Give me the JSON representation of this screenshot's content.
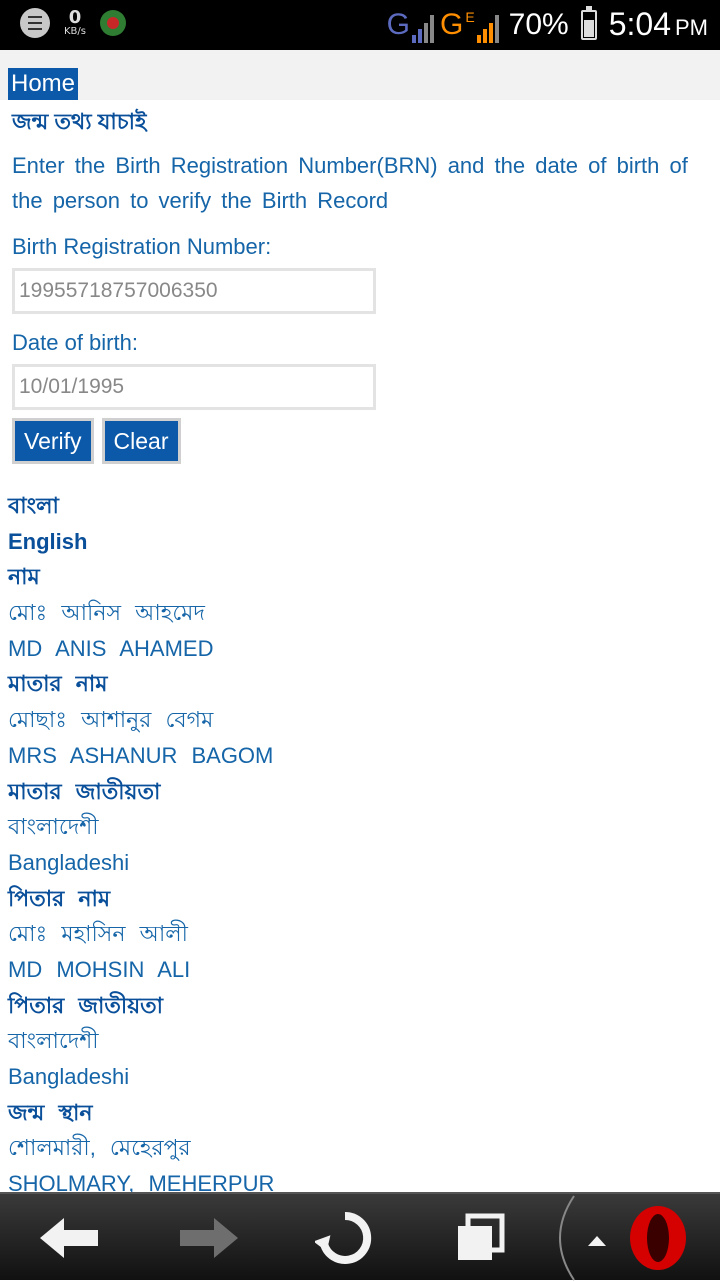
{
  "status_bar": {
    "data_speed_value": "0",
    "data_speed_unit": "KB/s",
    "network_1": "G",
    "network_2": "G",
    "network_2_sup": "E",
    "battery": "70%",
    "time": "5:04",
    "ampm": "PM"
  },
  "nav": {
    "home_label": "Home"
  },
  "form": {
    "title_bn": "জন্ম তথ্য যাচাই",
    "description": "Enter the Birth Registration Number(BRN) and the date of birth of the person to verify the Birth Record",
    "brn_label": "Birth Registration Number:",
    "brn_value": "19955718757006350",
    "dob_label": "Date of birth:",
    "dob_value": "10/01/1995",
    "verify_label": "Verify",
    "clear_label": "Clear"
  },
  "record": {
    "lang_bn": "বাংলা",
    "lang_en": "English",
    "name_label": "নাম",
    "name_bn": "মোঃ আনিস আহমেদ",
    "name_en": "MD ANIS AHAMED",
    "mother_name_label": "মাতার নাম",
    "mother_name_bn": "মোছাঃ আশানুর বেগম",
    "mother_name_en": "MRS ASHANUR BAGOM",
    "mother_nationality_label": "মাতার জাতীয়তা",
    "mother_nationality_bn": "বাংলাদেশী",
    "mother_nationality_en": "Bangladeshi",
    "father_name_label": "পিতার নাম",
    "father_name_bn": "মোঃ মহাসিন আলী",
    "father_name_en": "MD MOHSIN ALI",
    "father_nationality_label": "পিতার জাতীয়তা",
    "father_nationality_bn": "বাংলাদেশী",
    "father_nationality_en": "Bangladeshi",
    "birth_place_label": "জন্ম স্থান",
    "birth_place_bn": "শোলমারী, মেহেরপুর",
    "birth_place_en": "SHOLMARY, MEHERPUR"
  },
  "colors": {
    "accent": "#0b59a8",
    "text": "#1565a8",
    "network_blue": "#5c6bc0",
    "network_orange": "#ff8f00"
  },
  "icons": [
    "chat-notification-icon",
    "missed-call-icon",
    "signal-icon",
    "battery-icon",
    "back-arrow-icon",
    "forward-arrow-icon",
    "reload-icon",
    "tabs-icon",
    "opera-logo-icon"
  ]
}
